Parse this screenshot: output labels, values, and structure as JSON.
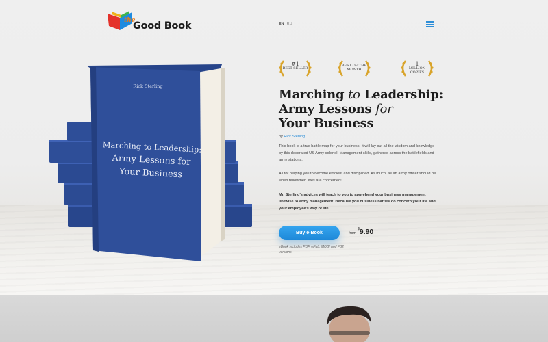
{
  "brand": {
    "prefix": "the",
    "name": "Good Book"
  },
  "languages": [
    {
      "code": "EN",
      "active": true
    },
    {
      "code": "RU",
      "active": false
    }
  ],
  "menu": {
    "icon": "hamburger-menu-icon"
  },
  "book_cover": {
    "author": "Rick Sterling",
    "title_line1": "Marching to Leadership:",
    "title_line2": "Army Lessons for",
    "title_line3": "Your Business",
    "color": "#2f4f9a"
  },
  "awards": [
    {
      "big": "#1",
      "small": "Best Seller",
      "icon": "laurel-wreath-icon"
    },
    {
      "big": "",
      "small": "Best of the Month",
      "icon": "laurel-wreath-icon"
    },
    {
      "big": "1",
      "small": "Million Copies",
      "icon": "laurel-wreath-icon"
    }
  ],
  "product": {
    "title_part1": "Marching ",
    "title_part2": "to",
    "title_part3": " Leadership:",
    "title_part4": "Army Lessons ",
    "title_part5": "for",
    "title_part6": "Your Business",
    "by": "by",
    "author": "Rick Sterling",
    "description1": "This book is a true battle map for your business! It will lay out all the wisdom and knowledge by this decorated US Army colonel. Management skills, gathered across the battlefields and army stations.",
    "description2": "All for helping you to become efficient and disciplined. As much, as an army officer should be when fellowmen lives are concerned!",
    "description3": "Mr. Sterling's advices will teach to you to apprehend your business management likewise to army management. Because you business battles do concern your life and your employee's way of life!",
    "buy_label": "Buy e-Book",
    "price_from": "from",
    "currency": "$",
    "price": "9.90",
    "formats": "eBook includes PDF, ePub, MOBI and FB2 versions"
  },
  "colors": {
    "accent": "#2f8fd8",
    "book_blue": "#2f4f9a",
    "logo_orange": "#e37b1b"
  }
}
